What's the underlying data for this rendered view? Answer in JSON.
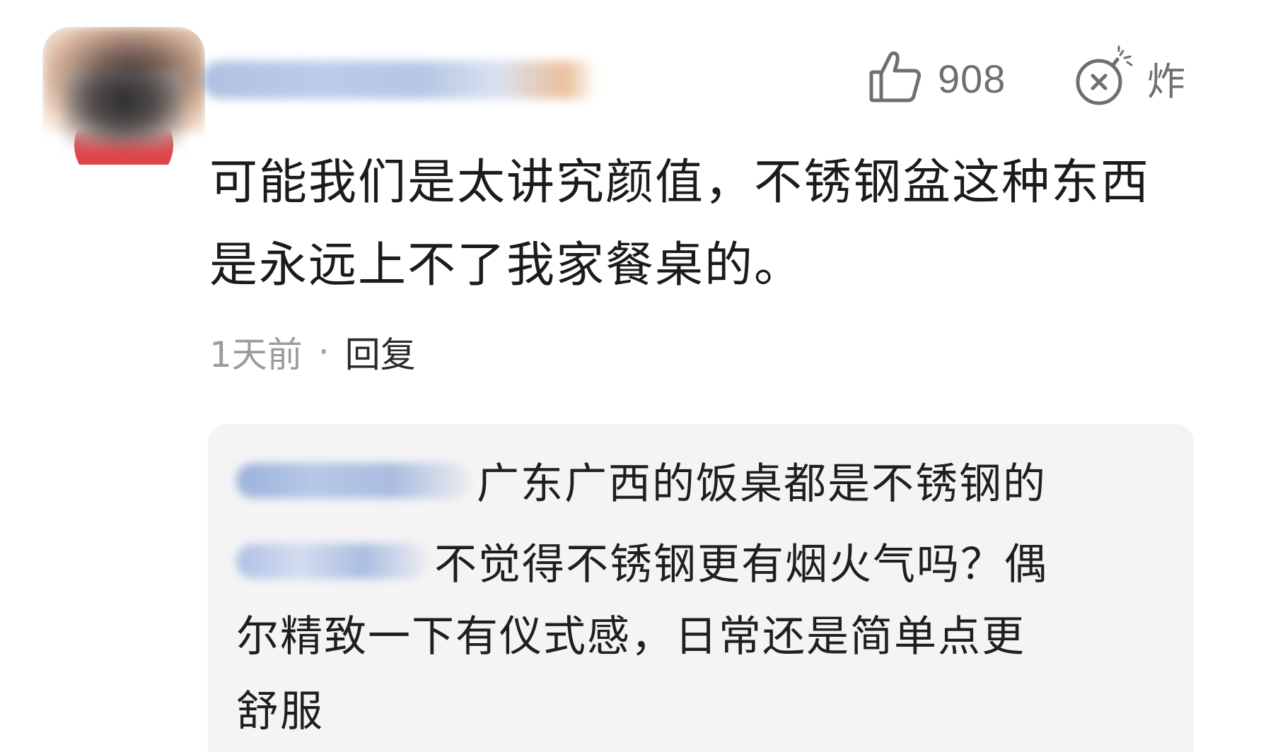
{
  "comment": {
    "text": "可能我们是太讲究颜值，不锈钢盆这种东西是永远上不了我家餐桌的。",
    "time": "1天前",
    "separator": "·",
    "reply_label": "回复"
  },
  "actions": {
    "like_icon": "thumbs-up-icon",
    "like_count": "908",
    "bomb_icon": "bomb-icon",
    "bomb_label": "炸"
  },
  "replies": [
    {
      "text": "广东广西的饭桌都是不锈钢的"
    },
    {
      "text_line1": "不觉得不锈钢更有烟火气吗？偶",
      "text_line2": "尔精致一下有仪式感，日常还是简单点更",
      "text_line3": "舒服"
    }
  ],
  "colors": {
    "text_primary": "#1b1b1b",
    "text_secondary": "#9c9c9c",
    "icon_gray": "#6f6f6f",
    "reply_bg": "#f4f4f5"
  }
}
